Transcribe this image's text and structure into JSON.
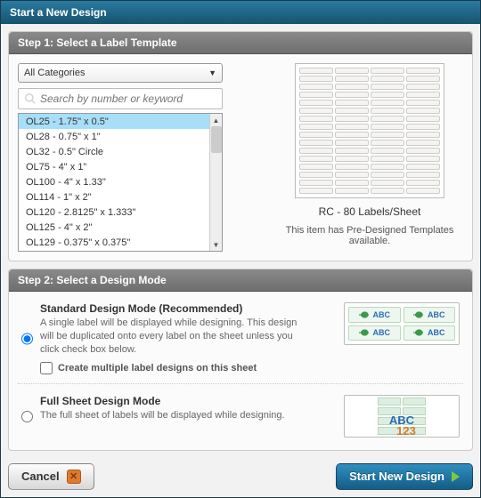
{
  "window": {
    "title": "Start a New Design"
  },
  "step1": {
    "heading": "Step 1: Select a Label Template",
    "category": "All Categories",
    "search_placeholder": "Search by number or keyword",
    "items": [
      {
        "label": "OL25 - 1.75\" x 0.5\"",
        "selected": true
      },
      {
        "label": "OL28 - 0.75\" x 1\""
      },
      {
        "label": "OL32 - 0.5\" Circle"
      },
      {
        "label": "OL75 - 4\" x 1\""
      },
      {
        "label": "OL100 - 4\" x 1.33\""
      },
      {
        "label": "OL114 - 1\" x 2\""
      },
      {
        "label": "OL120 - 2.8125\" x 1.333\""
      },
      {
        "label": "OL125 - 4\" x 2\""
      },
      {
        "label": "OL129 - 0.375\" x 0.375\""
      }
    ],
    "preview_caption": "RC - 80 Labels/Sheet",
    "preview_note": "This item has Pre-Designed Templates available."
  },
  "step2": {
    "heading": "Step 2: Select a Design Mode",
    "standard": {
      "title": "Standard Design Mode (Recommended)",
      "desc": "A single label will be displayed while designing. This design will be duplicated onto every label on the sheet unless you click check box below.",
      "checkbox_label": "Create multiple label designs on this sheet",
      "sample_text": "ABC"
    },
    "fullsheet": {
      "title": "Full Sheet Design Mode",
      "desc": "The full sheet of labels will be displayed while designing.",
      "sample_text": "ABC",
      "sample_nums": "123"
    }
  },
  "footer": {
    "cancel": "Cancel",
    "start": "Start New Design"
  }
}
